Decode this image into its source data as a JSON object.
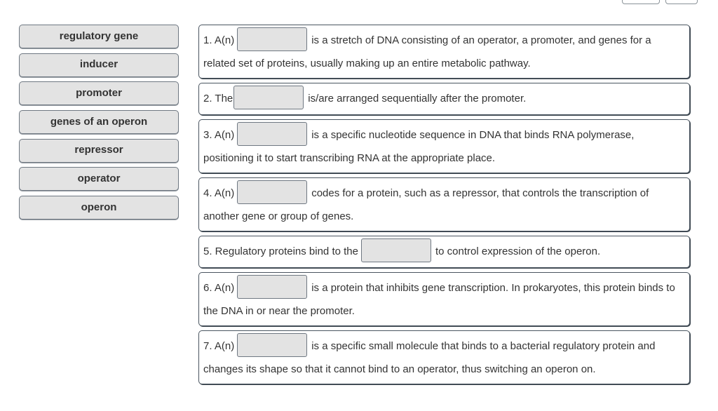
{
  "word_bank": [
    {
      "label": "regulatory gene"
    },
    {
      "label": "inducer"
    },
    {
      "label": "promoter"
    },
    {
      "label": "genes of an operon"
    },
    {
      "label": "repressor"
    },
    {
      "label": "operator"
    },
    {
      "label": "operon"
    }
  ],
  "questions": [
    {
      "before": "1. A(n)",
      "after": "is a stretch of DNA consisting of an operator, a promoter, and genes for a related set of proteins, usually making up an entire metabolic pathway.",
      "answer": ""
    },
    {
      "before": "2. The",
      "after": "is/are arranged sequentially after the promoter.",
      "answer": ""
    },
    {
      "before": "3. A(n)",
      "after": "is a specific nucleotide sequence in DNA that binds RNA polymerase, positioning it to start transcribing RNA at the appropriate place.",
      "answer": ""
    },
    {
      "before": "4. A(n)",
      "after": "codes for a protein, such as a repressor, that controls the transcription of another gene or group of genes.",
      "answer": ""
    },
    {
      "before": "5. Regulatory proteins bind to the",
      "after": "to control expression of the operon.",
      "answer": ""
    },
    {
      "before": "6. A(n)",
      "after": "is a protein that inhibits gene transcription. In prokaryotes, this protein binds to the DNA in or near the promoter.",
      "answer": ""
    },
    {
      "before": "7. A(n)",
      "after": "is a specific small molecule that binds to a bacterial regulatory protein and changes its shape so that it cannot bind to an operator, thus switching an operon on.",
      "answer": ""
    }
  ]
}
